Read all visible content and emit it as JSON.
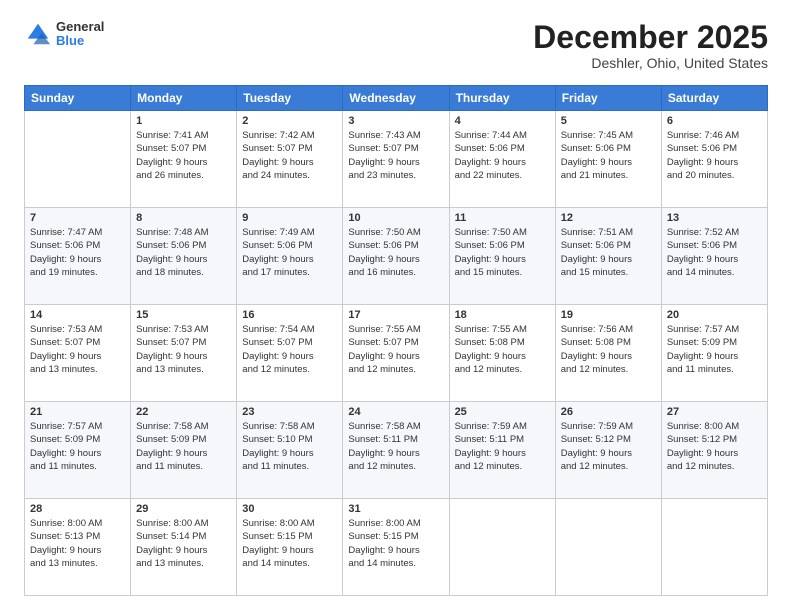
{
  "logo": {
    "general": "General",
    "blue": "Blue"
  },
  "header": {
    "month": "December 2025",
    "location": "Deshler, Ohio, United States"
  },
  "weekdays": [
    "Sunday",
    "Monday",
    "Tuesday",
    "Wednesday",
    "Thursday",
    "Friday",
    "Saturday"
  ],
  "weeks": [
    [
      {
        "day": "",
        "info": ""
      },
      {
        "day": "1",
        "info": "Sunrise: 7:41 AM\nSunset: 5:07 PM\nDaylight: 9 hours\nand 26 minutes."
      },
      {
        "day": "2",
        "info": "Sunrise: 7:42 AM\nSunset: 5:07 PM\nDaylight: 9 hours\nand 24 minutes."
      },
      {
        "day": "3",
        "info": "Sunrise: 7:43 AM\nSunset: 5:07 PM\nDaylight: 9 hours\nand 23 minutes."
      },
      {
        "day": "4",
        "info": "Sunrise: 7:44 AM\nSunset: 5:06 PM\nDaylight: 9 hours\nand 22 minutes."
      },
      {
        "day": "5",
        "info": "Sunrise: 7:45 AM\nSunset: 5:06 PM\nDaylight: 9 hours\nand 21 minutes."
      },
      {
        "day": "6",
        "info": "Sunrise: 7:46 AM\nSunset: 5:06 PM\nDaylight: 9 hours\nand 20 minutes."
      }
    ],
    [
      {
        "day": "7",
        "info": "Sunrise: 7:47 AM\nSunset: 5:06 PM\nDaylight: 9 hours\nand 19 minutes."
      },
      {
        "day": "8",
        "info": "Sunrise: 7:48 AM\nSunset: 5:06 PM\nDaylight: 9 hours\nand 18 minutes."
      },
      {
        "day": "9",
        "info": "Sunrise: 7:49 AM\nSunset: 5:06 PM\nDaylight: 9 hours\nand 17 minutes."
      },
      {
        "day": "10",
        "info": "Sunrise: 7:50 AM\nSunset: 5:06 PM\nDaylight: 9 hours\nand 16 minutes."
      },
      {
        "day": "11",
        "info": "Sunrise: 7:50 AM\nSunset: 5:06 PM\nDaylight: 9 hours\nand 15 minutes."
      },
      {
        "day": "12",
        "info": "Sunrise: 7:51 AM\nSunset: 5:06 PM\nDaylight: 9 hours\nand 15 minutes."
      },
      {
        "day": "13",
        "info": "Sunrise: 7:52 AM\nSunset: 5:06 PM\nDaylight: 9 hours\nand 14 minutes."
      }
    ],
    [
      {
        "day": "14",
        "info": "Sunrise: 7:53 AM\nSunset: 5:07 PM\nDaylight: 9 hours\nand 13 minutes."
      },
      {
        "day": "15",
        "info": "Sunrise: 7:53 AM\nSunset: 5:07 PM\nDaylight: 9 hours\nand 13 minutes."
      },
      {
        "day": "16",
        "info": "Sunrise: 7:54 AM\nSunset: 5:07 PM\nDaylight: 9 hours\nand 12 minutes."
      },
      {
        "day": "17",
        "info": "Sunrise: 7:55 AM\nSunset: 5:07 PM\nDaylight: 9 hours\nand 12 minutes."
      },
      {
        "day": "18",
        "info": "Sunrise: 7:55 AM\nSunset: 5:08 PM\nDaylight: 9 hours\nand 12 minutes."
      },
      {
        "day": "19",
        "info": "Sunrise: 7:56 AM\nSunset: 5:08 PM\nDaylight: 9 hours\nand 12 minutes."
      },
      {
        "day": "20",
        "info": "Sunrise: 7:57 AM\nSunset: 5:09 PM\nDaylight: 9 hours\nand 11 minutes."
      }
    ],
    [
      {
        "day": "21",
        "info": "Sunrise: 7:57 AM\nSunset: 5:09 PM\nDaylight: 9 hours\nand 11 minutes."
      },
      {
        "day": "22",
        "info": "Sunrise: 7:58 AM\nSunset: 5:09 PM\nDaylight: 9 hours\nand 11 minutes."
      },
      {
        "day": "23",
        "info": "Sunrise: 7:58 AM\nSunset: 5:10 PM\nDaylight: 9 hours\nand 11 minutes."
      },
      {
        "day": "24",
        "info": "Sunrise: 7:58 AM\nSunset: 5:11 PM\nDaylight: 9 hours\nand 12 minutes."
      },
      {
        "day": "25",
        "info": "Sunrise: 7:59 AM\nSunset: 5:11 PM\nDaylight: 9 hours\nand 12 minutes."
      },
      {
        "day": "26",
        "info": "Sunrise: 7:59 AM\nSunset: 5:12 PM\nDaylight: 9 hours\nand 12 minutes."
      },
      {
        "day": "27",
        "info": "Sunrise: 8:00 AM\nSunset: 5:12 PM\nDaylight: 9 hours\nand 12 minutes."
      }
    ],
    [
      {
        "day": "28",
        "info": "Sunrise: 8:00 AM\nSunset: 5:13 PM\nDaylight: 9 hours\nand 13 minutes."
      },
      {
        "day": "29",
        "info": "Sunrise: 8:00 AM\nSunset: 5:14 PM\nDaylight: 9 hours\nand 13 minutes."
      },
      {
        "day": "30",
        "info": "Sunrise: 8:00 AM\nSunset: 5:15 PM\nDaylight: 9 hours\nand 14 minutes."
      },
      {
        "day": "31",
        "info": "Sunrise: 8:00 AM\nSunset: 5:15 PM\nDaylight: 9 hours\nand 14 minutes."
      },
      {
        "day": "",
        "info": ""
      },
      {
        "day": "",
        "info": ""
      },
      {
        "day": "",
        "info": ""
      }
    ]
  ]
}
